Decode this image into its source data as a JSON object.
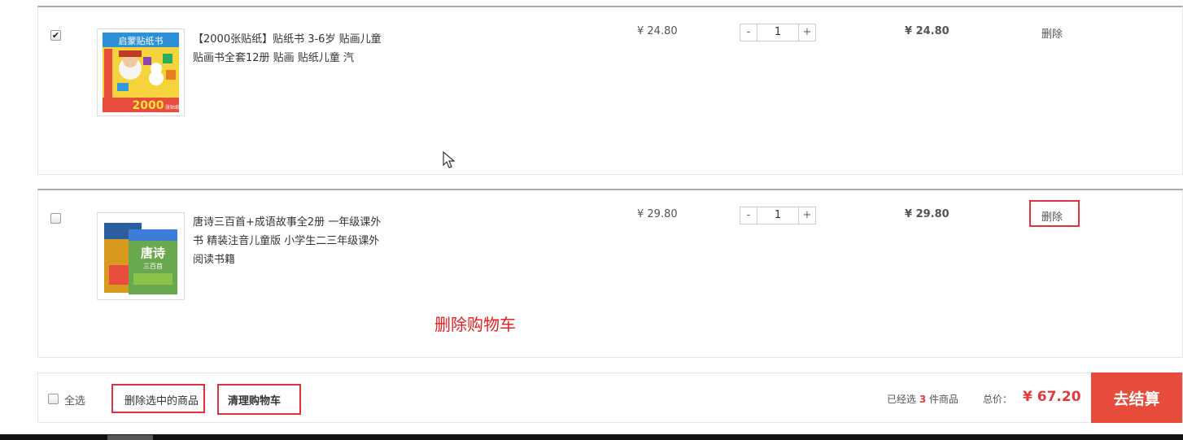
{
  "items": [
    {
      "checked": true,
      "title": "【2000张贴纸】贴纸书 3-6岁 贴画儿童 贴画书全套12册 贴画 贴纸儿童 汽",
      "price": "¥ 24.80",
      "quantity": "1",
      "subtotal": "¥ 24.80",
      "delete_label": "删除",
      "thumb_title": "启蒙贴纸书",
      "thumb_count": "2000",
      "thumb_unit": "张贴纸"
    },
    {
      "checked": false,
      "title": "唐诗三百首+成语故事全2册 一年级课外书 精装注音儿童版 小学生二三年级课外阅读书籍",
      "price": "¥ 29.80",
      "quantity": "1",
      "subtotal": "¥ 29.80",
      "delete_label": "删除",
      "thumb_title": "唐诗",
      "thumb_subtitle": "三百首"
    }
  ],
  "qty_controls": {
    "minus": "-",
    "plus": "+"
  },
  "annotation": "删除购物车",
  "footer": {
    "select_all_label": "全选",
    "delete_selected_label": "删除选中的商品",
    "clear_cart_label": "清理购物车",
    "selected_prefix": "已经选",
    "selected_count": "3",
    "selected_suffix": "件商品",
    "total_label": "总价：",
    "total_value": "¥ 67.20",
    "checkout_label": "去结算"
  },
  "colors": {
    "accent_red": "#e64b3b",
    "price_red": "#e4393c",
    "annotation_red": "#e32020"
  }
}
